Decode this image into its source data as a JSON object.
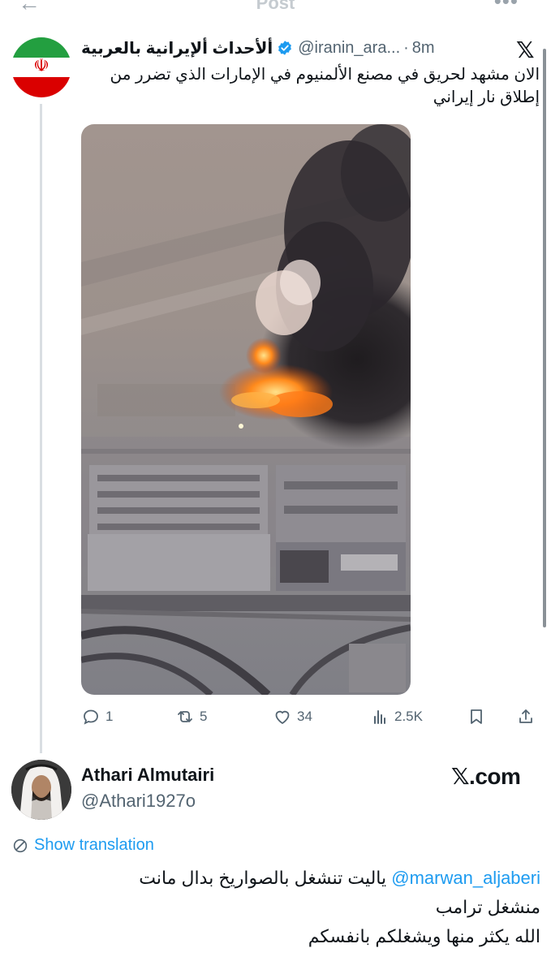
{
  "topbar": {
    "back_icon": "arrow-left-icon",
    "title": "Post",
    "more_icon": "more-icon"
  },
  "quoted": {
    "avatar": "iran-flag-avatar",
    "name": "ألأحداث ألإيرانية بالعربية",
    "handle": "@iranin_ara...",
    "separator": "·",
    "time": "8m",
    "source_icon": "x-logo-icon",
    "text": "الان مشهد لحريق في  مصنع الألمنيوم في الإمارات الذي تضرر من إطلاق نار إيراني",
    "media": "aerial-fire-smoke-photo",
    "actions": {
      "replies": "1",
      "reposts": "5",
      "likes": "34",
      "views": "2.5K"
    }
  },
  "reply": {
    "name": "Athari Almutairi",
    "handle": "@Athari1927o",
    "brand": "𝕏.com",
    "show_translation": "Show translation",
    "mention": "@marwan_aljaberi",
    "line1": "ياليت تنشغل بالصواريخ بدال مانت",
    "line2": "منشغل ترامب",
    "line3": "الله يكثر منها ويشغلكم بانفسكم"
  },
  "colors": {
    "accent": "#1d9bf0",
    "text": "#0f1419",
    "muted": "#536471"
  }
}
